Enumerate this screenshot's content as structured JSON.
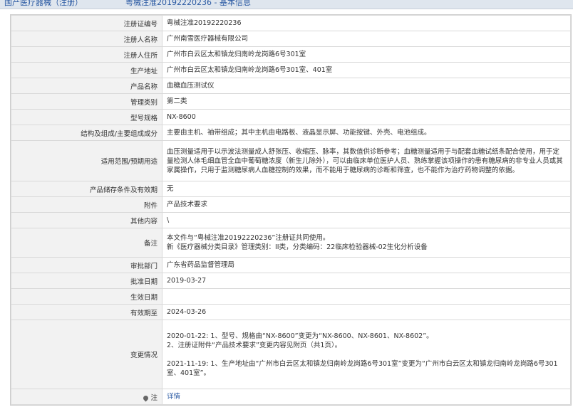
{
  "header": {
    "left_text": "国产医疗器械（注册）",
    "right_text": "粤械注准20192220236 - 基本信息"
  },
  "rows": [
    {
      "label": "注册证编号",
      "value": "粤械注准20192220236"
    },
    {
      "label": "注册人名称",
      "value": "广州南雪医疗器械有限公司"
    },
    {
      "label": "注册人住所",
      "value": "广州市白云区太和镇龙归南岭龙岗路6号301室"
    },
    {
      "label": "生产地址",
      "value": "广州市白云区太和镇龙归南岭龙岗路6号301室、401室"
    },
    {
      "label": "产品名称",
      "value": "血糖血压测试仪"
    },
    {
      "label": "管理类别",
      "value": "第二类"
    },
    {
      "label": "型号规格",
      "value": "NX-8600"
    },
    {
      "label": "结构及组成/主要组成成分",
      "value": "主要由主机、袖带组成；其中主机由电路板、液晶显示屏、功能按键、外壳、电池组成。"
    },
    {
      "label": "适用范围/预期用途",
      "value": "血压测量适用于以示波法测量成人舒张压、收缩压、脉率，其数值供诊断参考；血糖测量适用于与配套血糖试纸条配合使用，用于定量检测人体毛细血管全血中葡萄糖浓度（新生儿除外），可以由临床单位医护人员、熟练掌握该项操作的患有糖尿病的非专业人员或其家属操作，只用于监测糖尿病人血糖控制的效果，而不能用于糖尿病的诊断和筛查，也不能作为治疗药物调整的依据。"
    },
    {
      "label": "产品储存条件及有效期",
      "value": "无"
    },
    {
      "label": "附件",
      "value": "产品技术要求"
    },
    {
      "label": "其他内容",
      "value": "\\"
    },
    {
      "label": "备注",
      "line1": "本文件与“粤械注准20192220236”注册证共同使用。",
      "line2": "新《医疗器械分类目录》管理类别：II类，分类编码：22临床检验器械-02生化分析设备"
    },
    {
      "label": "审批部门",
      "value": "广东省药品监督管理局"
    },
    {
      "label": "批准日期",
      "value": "2019-03-27"
    },
    {
      "label": "生效日期",
      "value": ""
    },
    {
      "label": "有效期至",
      "value": "2024-03-26"
    },
    {
      "label": "变更情况",
      "line1": "2020-01-22: 1、型号、规格由“NX-8600”变更为“NX-8600、NX-8601、NX-8602”。",
      "line2": "2、注册证附件“产品技术要求”变更内容见附页（共1页）。",
      "line3": "2021-11-19: 1、生产地址由“广州市白云区太和镇龙归南岭龙岗路6号301室”变更为“广州市白云区太和镇龙归南岭龙岗路6号301室、401室”。"
    },
    {
      "label": "注",
      "value": "详情"
    }
  ]
}
